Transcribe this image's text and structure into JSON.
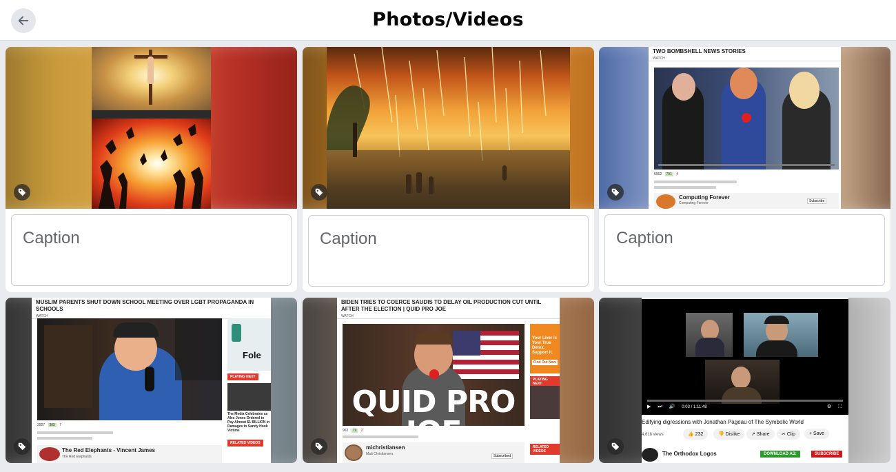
{
  "header": {
    "title": "Photos/Videos",
    "back_icon": "arrow-left-icon"
  },
  "colors": {
    "background": "#e9ebee",
    "card": "#ffffff",
    "tag_button": "#282828",
    "youtube_red": "#e02020"
  },
  "cards": [
    {
      "caption_placeholder": "Caption",
      "tag_icon": "tag-icon"
    },
    {
      "caption_placeholder": "Caption",
      "tag_icon": "tag-icon"
    },
    {
      "caption_placeholder": "Caption",
      "tag_icon": "tag-icon",
      "screenshot": {
        "title": "TWO BOMBSHELL NEWS STORIES",
        "watch": "WATCH",
        "views": "6062",
        "likes": "791",
        "dislikes": "4",
        "channel": "Computing Forever",
        "channel_sub": "Computing Forever",
        "subscribe": "Subscribe"
      }
    },
    {
      "tag_icon": "tag-icon",
      "screenshot": {
        "title": "MUSLIM PARENTS SHUT DOWN SCHOOL MEETING OVER LGBT PROPAGANDA IN SCHOOLS",
        "watch": "WATCH",
        "views": "2927",
        "likes": "305",
        "dislikes": "7",
        "playing_next": "PLAYING NEXT",
        "related": "RELATED VIDEOS",
        "channel": "The Red Elephants - Vincent James",
        "channel_sub": "The Red Elephants",
        "side_text": "The Media Celebrates as Alex Jones Ordered to Pay Almost $1 BILLION in Damages to Sandy Hook Victims"
      }
    },
    {
      "tag_icon": "tag-icon",
      "screenshot": {
        "title": "BIDEN TRIES TO COERCE SAUDIS TO DELAY OIL PRODUCTION CUT UNTIL AFTER THE ELECTION | QUID PRO JOE",
        "watch": "WATCH",
        "overlay": "QUID PRO JOE",
        "views": "962",
        "likes": "79",
        "dislikes": "2",
        "playing_next": "PLAYING NEXT",
        "related": "RELATED VIDEOS",
        "channel": "michristiansen",
        "channel_sub": "Matt Christiansen",
        "subscribe": "Subscribed",
        "side_ad": "Your Liver is Your True Detox. Support It.",
        "find_now": "Find Out Now"
      }
    },
    {
      "tag_icon": "tag-icon",
      "screenshot": {
        "time": "0:03 / 1:11:48",
        "video_title": "Edifying digressions with Jonathan Pageau of The Symbolic World",
        "views": "4,618 views",
        "likes": "232",
        "dislike": "Dislike",
        "share": "Share",
        "clip": "Clip",
        "save": "Save",
        "channel": "The Orthodox Logos",
        "download": "DOWNLOAD AS:",
        "subscribe": "SUBSCRIBE"
      }
    }
  ]
}
